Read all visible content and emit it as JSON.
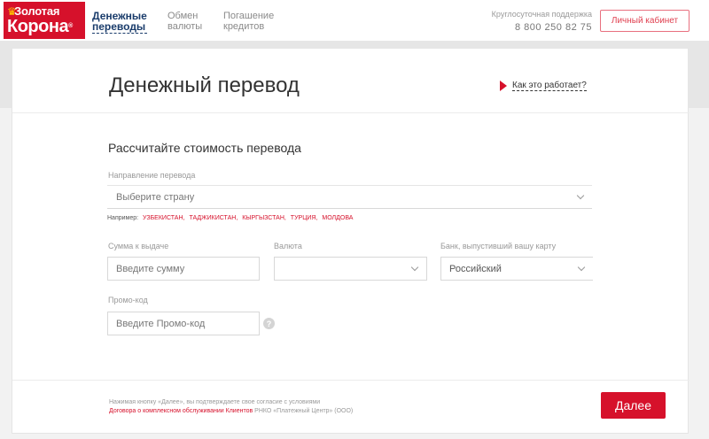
{
  "header": {
    "logo": {
      "line1": "Золотая",
      "line2": "Корона",
      "reg": "®",
      "crown_icon": "crown-icon"
    },
    "nav": [
      {
        "line1": "Денежные",
        "line2": "переводы",
        "active": true
      },
      {
        "line1": "Обмен",
        "line2": "валюты",
        "active": false
      },
      {
        "line1": "Погашение",
        "line2": "кредитов",
        "active": false
      }
    ],
    "support_label": "Круглосуточная поддержка",
    "support_phone": "8 800 250 82 75",
    "cabinet_label": "Личный кабинет"
  },
  "card": {
    "title": "Денежный перевод",
    "how_it_works": "Как это работает?",
    "section_title": "Рассчитайте стоимость перевода",
    "direction": {
      "label": "Направление перевода",
      "placeholder": "Выберите страну",
      "example_prefix": "Например:",
      "examples": [
        "УЗБЕКИСТАН,",
        "ТАДЖИКИСТАН,",
        "КЫРГЫЗСТАН,",
        "ТУРЦИЯ,",
        "МОЛДОВА"
      ]
    },
    "amount": {
      "label": "Сумма к выдаче",
      "placeholder": "Введите сумму"
    },
    "currency": {
      "label": "Валюта",
      "value": ""
    },
    "bank": {
      "label": "Банк, выпустивший вашу карту",
      "value": "Российский"
    },
    "promo": {
      "label": "Промо-код",
      "placeholder": "Введите Промо-код",
      "help": "?"
    },
    "footnote": {
      "line1": "Нажимая кнопку «Далее», вы подтверждаете свое согласие с условиями",
      "link": "Договора о комплексном обслуживании Клиентов",
      "line2_rest": " РНКО «Платежный Центр» (ООО)"
    },
    "next_label": "Далее"
  },
  "colors": {
    "brand_red": "#d6112b",
    "nav_active": "#1a3c6b"
  }
}
